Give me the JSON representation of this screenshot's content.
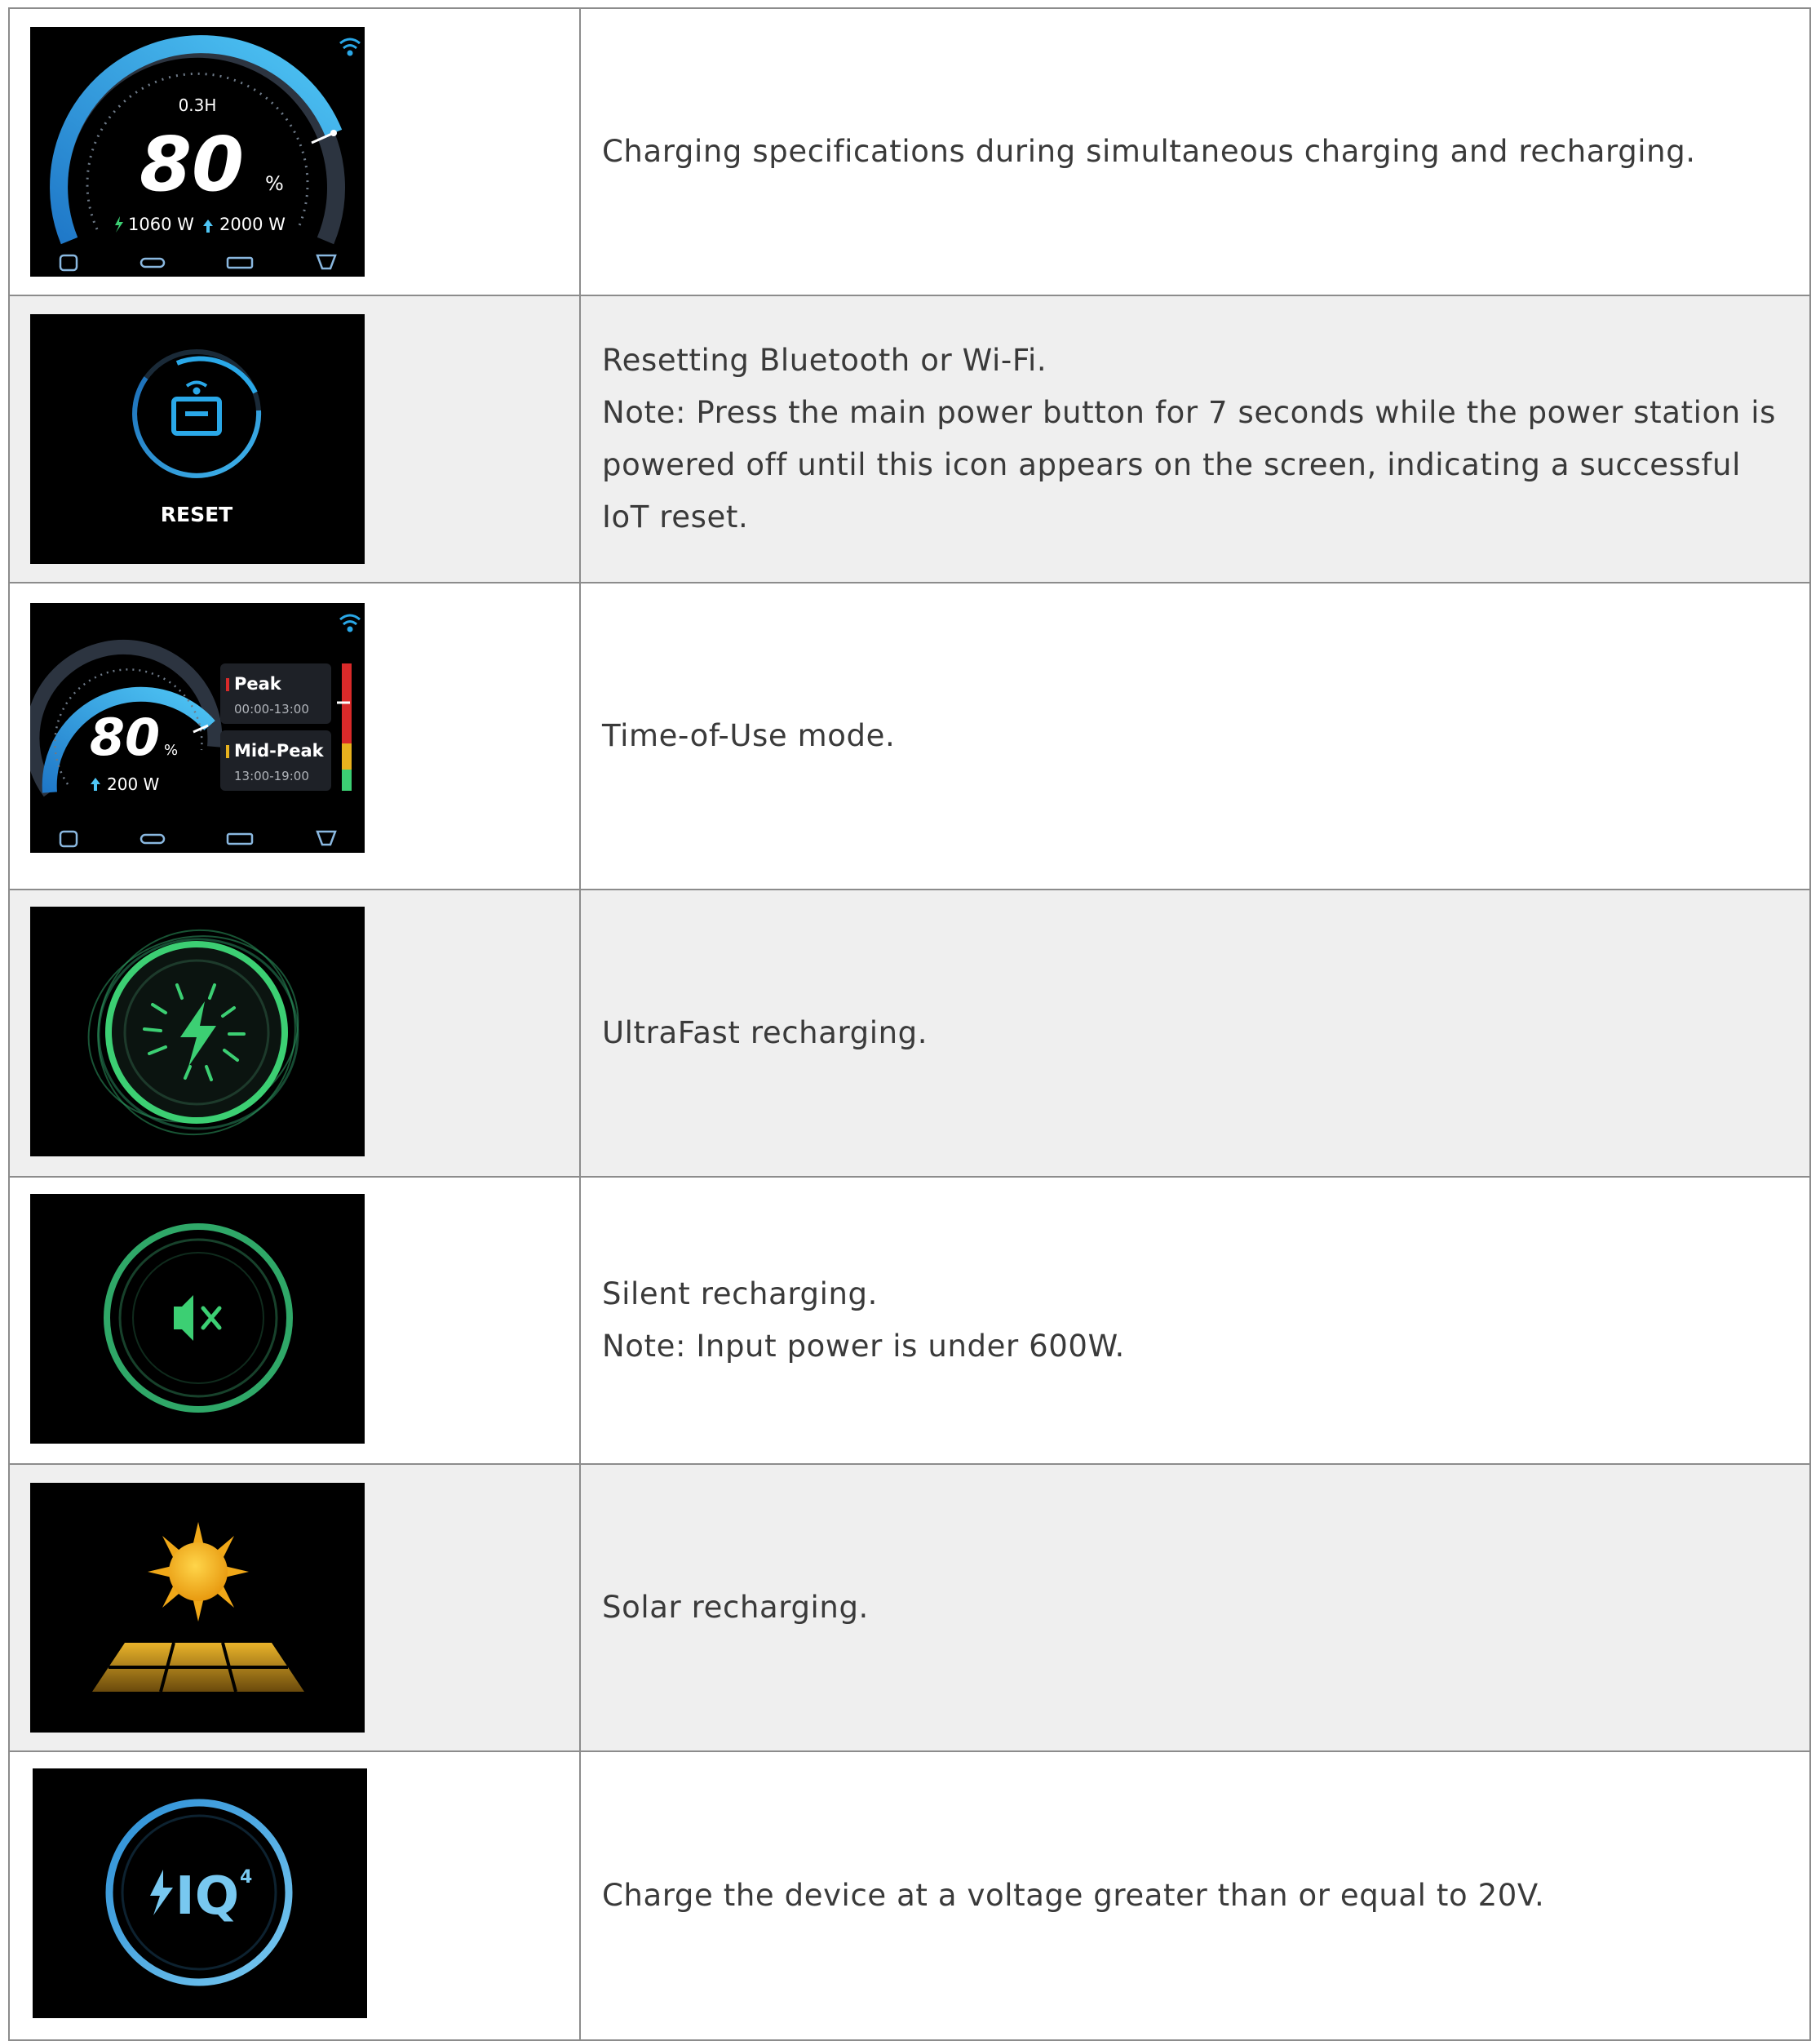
{
  "rows": [
    {
      "icon": "charging-gauge-screen",
      "screen": {
        "remaining_time": "0.3H",
        "percent": "80",
        "percent_unit": "%",
        "input_power": "1060 W",
        "output_power": "2000 W"
      },
      "lines": [
        "Charging specifications during simultaneous charging and recharging."
      ]
    },
    {
      "icon": "reset-screen",
      "screen": {
        "label": "RESET"
      },
      "lines": [
        "Resetting Bluetooth or Wi-Fi.",
        "Note: Press the main power button for 7 seconds while the power station is powered off until this icon appears on the screen, indicating a successful IoT reset."
      ]
    },
    {
      "icon": "time-of-use-screen",
      "screen": {
        "percent": "80",
        "percent_unit": "%",
        "output_power": "200 W",
        "peak_label": "Peak",
        "peak_time": "00:00-13:00",
        "midpeak_label": "Mid-Peak",
        "midpeak_time": "13:00-19:00"
      },
      "lines": [
        "Time-of-Use mode."
      ]
    },
    {
      "icon": "ultrafast-recharging-screen",
      "lines": [
        "UltraFast recharging."
      ]
    },
    {
      "icon": "silent-recharging-screen",
      "lines": [
        "Silent recharging.",
        "Note: Input power is under 600W."
      ]
    },
    {
      "icon": "solar-recharging-screen",
      "lines": [
        "Solar recharging."
      ]
    },
    {
      "icon": "iq4-screen",
      "screen": {
        "label": "IQ",
        "superscript": "4"
      },
      "lines": [
        "Charge the device at a voltage greater than or equal to 20V."
      ]
    }
  ],
  "colors": {
    "gauge_blue": "#2aa8e8",
    "green": "#3ccf73",
    "peak_red": "#d92a2a",
    "midpeak_yellow": "#e8b21e",
    "sun": "#f5b324"
  }
}
